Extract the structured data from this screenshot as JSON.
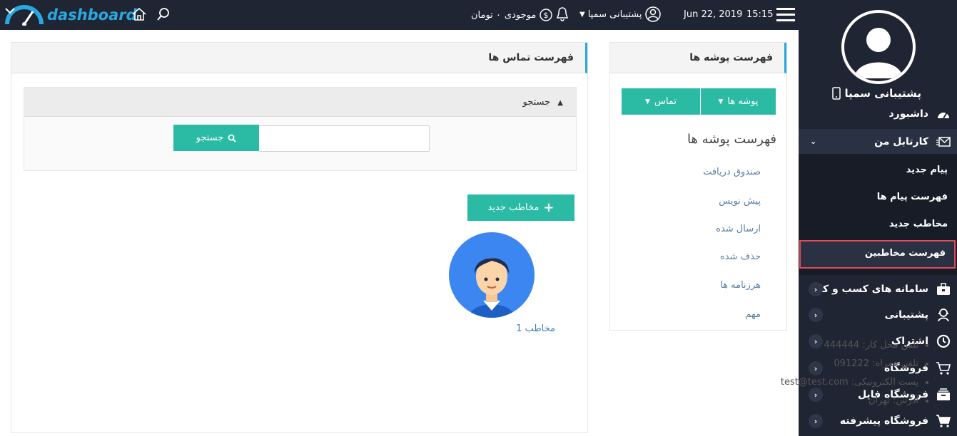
{
  "topbar": {
    "logo_text": "dashboard",
    "balance_label": "موجودی",
    "balance_value": "۰ تومان",
    "user_name": "پشتیبانی سمپا",
    "date": "Jun 22, 2019",
    "time": "15:15"
  },
  "sidebar": {
    "user_name": "پشتیبانی سمپا",
    "items": [
      {
        "label": "داشبورد",
        "icon": "speedometer-icon"
      },
      {
        "label": "کارتابل من",
        "icon": "envelope-icon"
      },
      {
        "label": "سامانه های کسب و کار",
        "icon": "briefcase-icon"
      },
      {
        "label": "پشتیبانی",
        "icon": "support-agent-icon"
      },
      {
        "label": "اشتراک",
        "icon": "clock-icon"
      },
      {
        "label": "فروشگاه",
        "icon": "cart-icon"
      },
      {
        "label": "فروشگاه فایل",
        "icon": "file-box-icon"
      },
      {
        "label": "فروشگاه پیشرفته",
        "icon": "cart-advanced-icon"
      }
    ],
    "submenu": [
      "پیام جدید",
      "فهرست پیام ها",
      "مخاطب جدید",
      "فهرست مخاطبین"
    ]
  },
  "folders_panel": {
    "title": "فهرست پوشه ها",
    "btn_folders": "پوشه ها",
    "btn_contact": "تماس",
    "list_title": "فهرست پوشه ها",
    "items": [
      "صندوق دریافت",
      "پیش نویس",
      "ارسال شده",
      "حذف شده",
      "هرزنامه ها",
      "مهم"
    ]
  },
  "contacts_panel": {
    "title": "فهرست تماس ها",
    "search_header": "جستجو",
    "search_button": "جستجو",
    "search_value": "",
    "new_contact_button": "مخاطب جدید",
    "contact": {
      "name": "مخاطب 1",
      "work_phone": "تلفن محل کار: 444444",
      "mobile": "تلفن همراه: 091222",
      "email": "پست الکترونیکی: test@test.com",
      "address": "آدرس: تهران"
    }
  },
  "colors": {
    "dark": "#1f2532",
    "accent": "#29a8e0",
    "teal": "#2bbba5",
    "active_border": "#e04c57"
  }
}
